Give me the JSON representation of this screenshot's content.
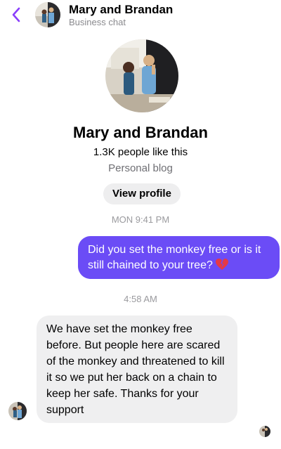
{
  "header": {
    "title": "Mary and Brandan",
    "subtitle": "Business chat"
  },
  "profile": {
    "name": "Mary and Brandan",
    "likes": "1.3K people like this",
    "category": "Personal blog",
    "view_profile_label": "View profile"
  },
  "messages": [
    {
      "timestamp": "MON 9:41 PM",
      "direction": "outgoing",
      "text": "Did you set the monkey free or is it still chained to your tree?",
      "emoji": "broken-heart-icon"
    },
    {
      "timestamp": "4:58 AM",
      "direction": "incoming",
      "text": "We have set the monkey free before. But people here are scared of the monkey and threatened to kill it so we put her back on a chain to keep her safe. Thanks for your support"
    }
  ],
  "colors": {
    "accent": "#6b4cf6",
    "back_arrow": "#8a3ffc",
    "incoming_bubble": "#efeff0",
    "muted_text": "#8a8a8e"
  }
}
